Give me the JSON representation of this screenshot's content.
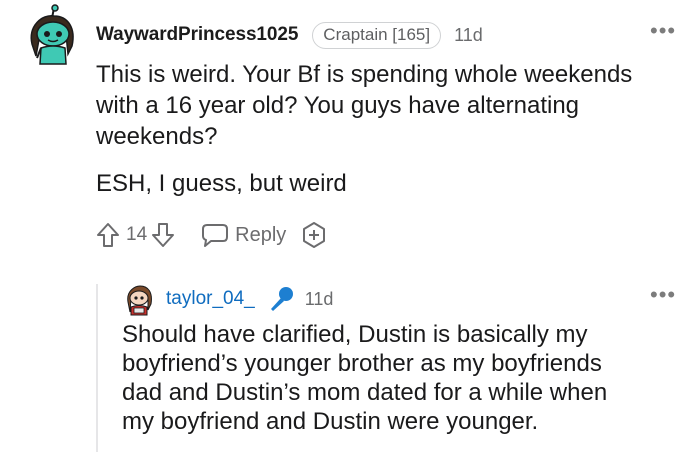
{
  "comment": {
    "username": "WaywardPrincess1025",
    "flair": "Craptain [165]",
    "age": "11d",
    "more": "•••",
    "paragraphs": [
      "This is weird. Your Bf is spending whole weekends with a 16 year old? You guys have alternating weekends?",
      "ESH, I guess, but weird"
    ],
    "votes": "14",
    "reply_label": "Reply"
  },
  "reply": {
    "username": "taylor_04_",
    "age": "11d",
    "more": "•••",
    "text": "Should have clarified, Dustin is basically my\nboyfriend’s younger brother as my boyfriends\ndad and Dustin’s mom dated for a while when\nmy boyfriend and Dustin were younger."
  },
  "colors": {
    "username_link": "#0f6cbf",
    "muted": "#6c6c6e",
    "snoo_teal": "#3fc9b4",
    "mic_blue": "#1d7fd1"
  },
  "icons": [
    "snoo-avatar-icon",
    "upvote-icon",
    "downvote-icon",
    "comment-bubble-icon",
    "award-icon",
    "microphone-icon",
    "more-options-icon"
  ]
}
